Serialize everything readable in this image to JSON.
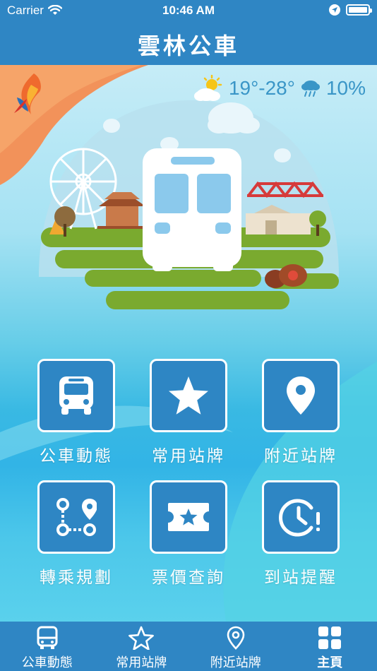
{
  "status_bar": {
    "carrier": "Carrier",
    "time": "10:46 AM"
  },
  "nav": {
    "title": "雲林公車"
  },
  "weather": {
    "temperature": "19°-28°",
    "rain_chance": "10%",
    "day_icon": "partly-sunny-icon",
    "rain_icon": "rain-cloud-icon"
  },
  "menu": {
    "tiles": [
      {
        "label": "公車動態",
        "icon": "bus-icon"
      },
      {
        "label": "常用站牌",
        "icon": "star-icon"
      },
      {
        "label": "附近站牌",
        "icon": "location-pin-icon"
      },
      {
        "label": "轉乘規劃",
        "icon": "route-icon"
      },
      {
        "label": "票價查詢",
        "icon": "ticket-icon"
      },
      {
        "label": "到站提醒",
        "icon": "alarm-clock-icon"
      }
    ]
  },
  "tab_bar": {
    "tabs": [
      {
        "label": "公車動態",
        "icon": "bus-icon"
      },
      {
        "label": "常用站牌",
        "icon": "star-icon"
      },
      {
        "label": "附近站牌",
        "icon": "location-pin-icon"
      },
      {
        "label": "主頁",
        "icon": "grid-icon",
        "active": true
      }
    ]
  },
  "colors": {
    "primary": "#2f86c4",
    "tile_border": "#ffffff",
    "weather_text": "#3a96c7",
    "grass": "#7aaa2f",
    "accent_orange": "#f2925a"
  }
}
